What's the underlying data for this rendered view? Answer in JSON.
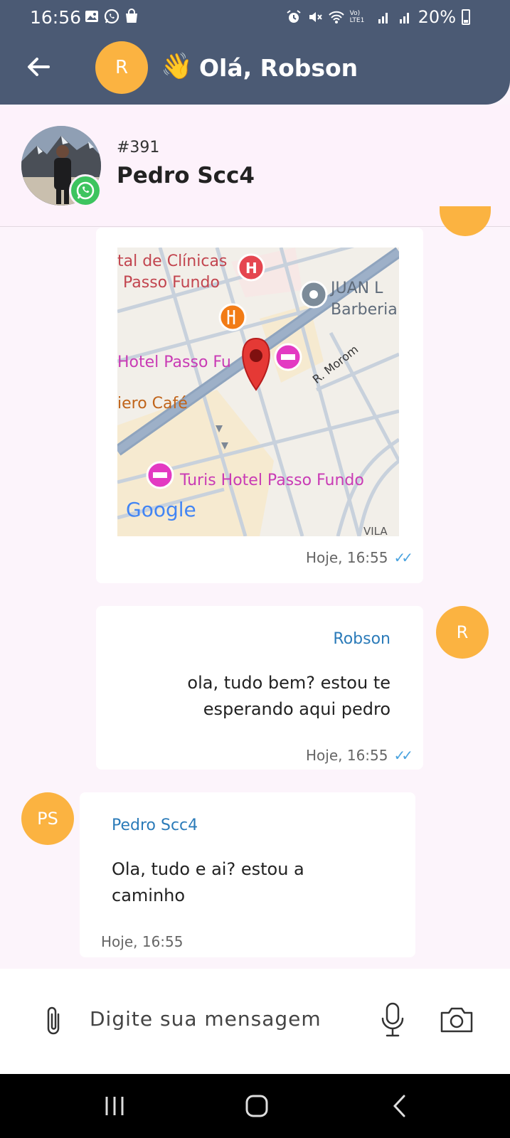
{
  "status_bar": {
    "time": "16:56",
    "battery": "20%",
    "network": "Vo) LTE1"
  },
  "header": {
    "avatar_letter": "R",
    "wave_emoji": "👋",
    "greeting": "Olá, Robson"
  },
  "contact": {
    "ticket": "#391",
    "name": "Pedro Scc4"
  },
  "map_labels": {
    "clinicas_1": "tal de Clínicas",
    "clinicas_2": "Passo Fundo",
    "juan_1": "JUAN L",
    "juan_2": "Barberia",
    "hotel": "Hotel Passo Fu",
    "street": "R. Morom",
    "cafe": "iero Café",
    "turis": "Turis Hotel Passo Fundo",
    "google": "Google",
    "vila": "VILA"
  },
  "messages": [
    {
      "type": "location",
      "time": "Hoje, 16:55",
      "ticks": "✓✓"
    },
    {
      "type": "text",
      "sender": "Robson",
      "text_line1": "ola, tudo bem? estou te",
      "text_line2": "esperando aqui pedro",
      "time": "Hoje, 16:55",
      "ticks": "✓✓",
      "avatar": "R"
    },
    {
      "type": "text",
      "sender": "Pedro Scc4",
      "text_line1": "Ola, tudo e ai? estou a",
      "text_line2": "caminho",
      "time": "Hoje, 16:55",
      "avatar": "PS"
    }
  ],
  "input": {
    "placeholder": "Digite sua mensagem"
  },
  "colors": {
    "header_bg": "#4b5a74",
    "avatar_bg": "#fbb341",
    "sender_name": "#2b7bb9",
    "read_ticks": "#4aa3df",
    "whatsapp_green": "#3dc45f"
  },
  "icons": [
    "image-icon",
    "whatsapp-icon",
    "bag-icon",
    "alarm-icon",
    "mute-icon",
    "wifi-icon",
    "signal-icon",
    "battery-icon",
    "back-arrow-icon",
    "paperclip-icon",
    "microphone-icon",
    "camera-icon",
    "recents-icon",
    "home-icon",
    "nav-back-icon"
  ]
}
